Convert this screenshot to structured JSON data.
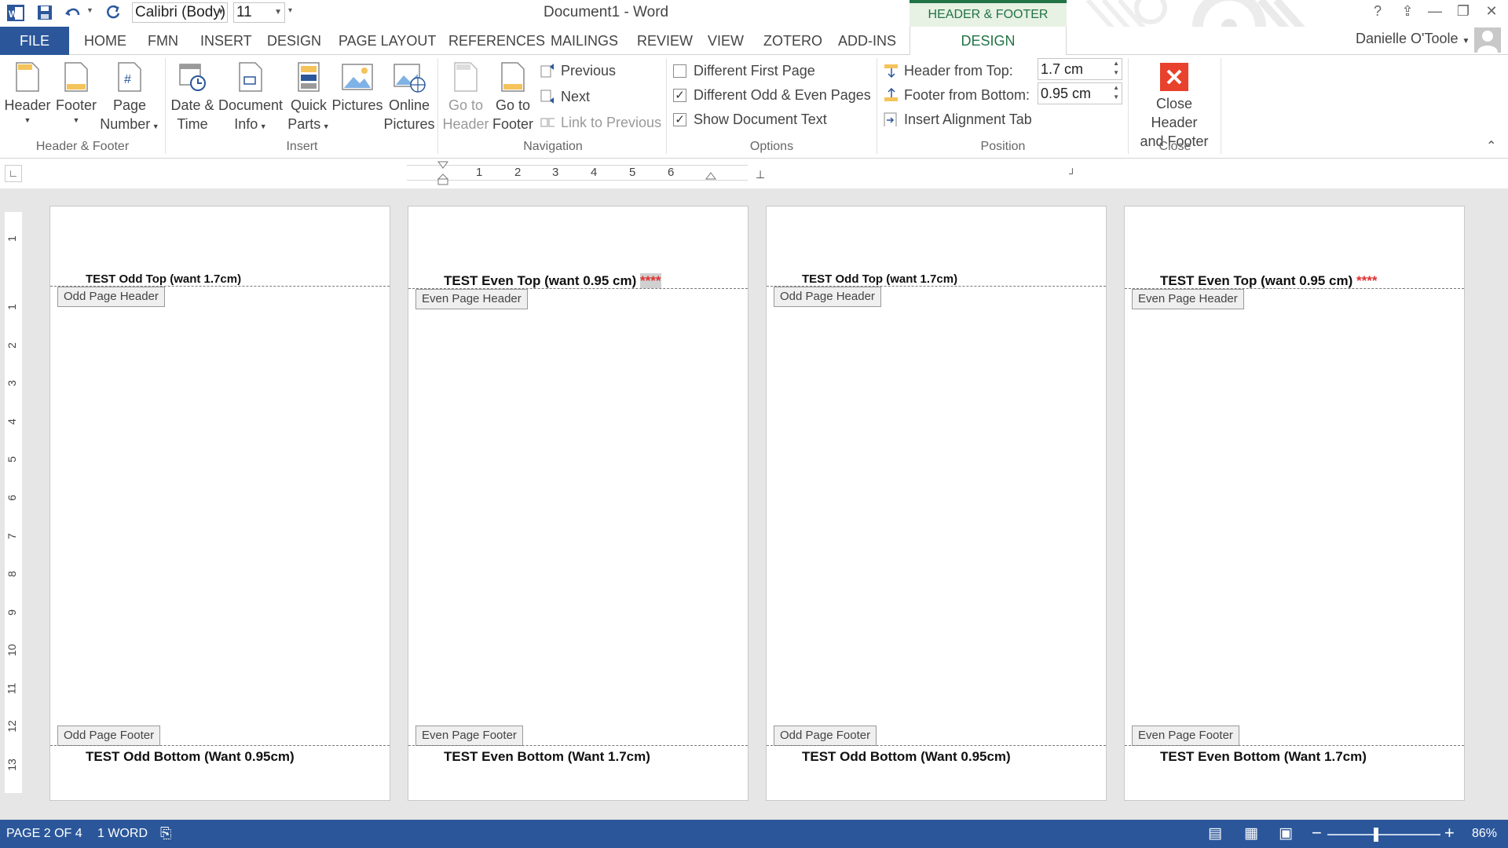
{
  "titlebar": {
    "font_name": "Calibri (Body)",
    "font_size": "11",
    "document_title": "Document1 - Word",
    "contextual_tools": "HEADER & FOOTER TOOLS",
    "help": "?",
    "user": "Danielle O'Toole"
  },
  "tabs": [
    "FILE",
    "HOME",
    "FMN",
    "INSERT",
    "DESIGN",
    "PAGE LAYOUT",
    "REFERENCES",
    "MAILINGS",
    "REVIEW",
    "VIEW",
    "ZOTERO",
    "ADD-INS",
    "DESIGN"
  ],
  "ribbon": {
    "header_footer": {
      "label": "Header & Footer",
      "header": "Header",
      "footer": "Footer",
      "page_number_1": "Page",
      "page_number_2": "Number"
    },
    "insert": {
      "label": "Insert",
      "date_time_1": "Date &",
      "date_time_2": "Time",
      "doc_info_1": "Document",
      "doc_info_2": "Info",
      "quick_parts_1": "Quick",
      "quick_parts_2": "Parts",
      "pictures": "Pictures",
      "online_pictures_1": "Online",
      "online_pictures_2": "Pictures"
    },
    "navigation": {
      "label": "Navigation",
      "goto_header_1": "Go to",
      "goto_header_2": "Header",
      "goto_footer_1": "Go to",
      "goto_footer_2": "Footer",
      "previous": "Previous",
      "next": "Next",
      "link_to_previous": "Link to Previous"
    },
    "options": {
      "label": "Options",
      "different_first_page": "Different First Page",
      "different_first_page_checked": false,
      "different_odd_even": "Different Odd & Even Pages",
      "different_odd_even_checked": true,
      "show_document_text": "Show Document Text",
      "show_document_text_checked": true
    },
    "position": {
      "label": "Position",
      "header_from_top": "Header from Top:",
      "header_from_top_value": "1.7 cm",
      "footer_from_bottom": "Footer from Bottom:",
      "footer_from_bottom_value": "0.95 cm",
      "insert_alignment_tab": "Insert Alignment Tab"
    },
    "close": {
      "label": "Close",
      "close_1": "Close Header",
      "close_2": "and Footer"
    }
  },
  "ruler": {
    "numbers": [
      "1",
      "2",
      "3",
      "4",
      "5",
      "6"
    ]
  },
  "vruler": {
    "numbers": [
      "1",
      "1",
      "2",
      "3",
      "4",
      "5",
      "6",
      "7",
      "8",
      "9",
      "10",
      "11",
      "12",
      "13"
    ]
  },
  "pages": [
    {
      "header_text": "TEST Odd Top (want 1.7cm)",
      "stars": "",
      "header_tag": "Odd Page Header",
      "footer_tag": "Odd Page Footer",
      "footer_text": "TEST Odd Bottom (Want 0.95cm)"
    },
    {
      "header_text": "TEST Even Top (want 0.95 cm)",
      "stars": "****",
      "header_tag": "Even Page Header",
      "footer_tag": "Even Page Footer",
      "footer_text": "TEST Even Bottom (Want 1.7cm)"
    },
    {
      "header_text": "TEST Odd Top (want 1.7cm)",
      "stars": "",
      "header_tag": "Odd Page Header",
      "footer_tag": "Odd Page Footer",
      "footer_text": "TEST Odd Bottom (Want 0.95cm)"
    },
    {
      "header_text": "TEST Even Top (want 0.95 cm)",
      "stars": "****",
      "header_tag": "Even Page Header",
      "footer_tag": "Even Page Footer",
      "footer_text": "TEST Even Bottom (Want 1.7cm)"
    }
  ],
  "status": {
    "page": "PAGE 2 OF 4",
    "words": "1 WORD",
    "zoom": "86%",
    "zoom_level": 0.43
  },
  "colors": {
    "word_blue": "#2b579a",
    "tools_green": "#217346",
    "close_red": "#e8412c",
    "stars_red": "#e03030"
  }
}
